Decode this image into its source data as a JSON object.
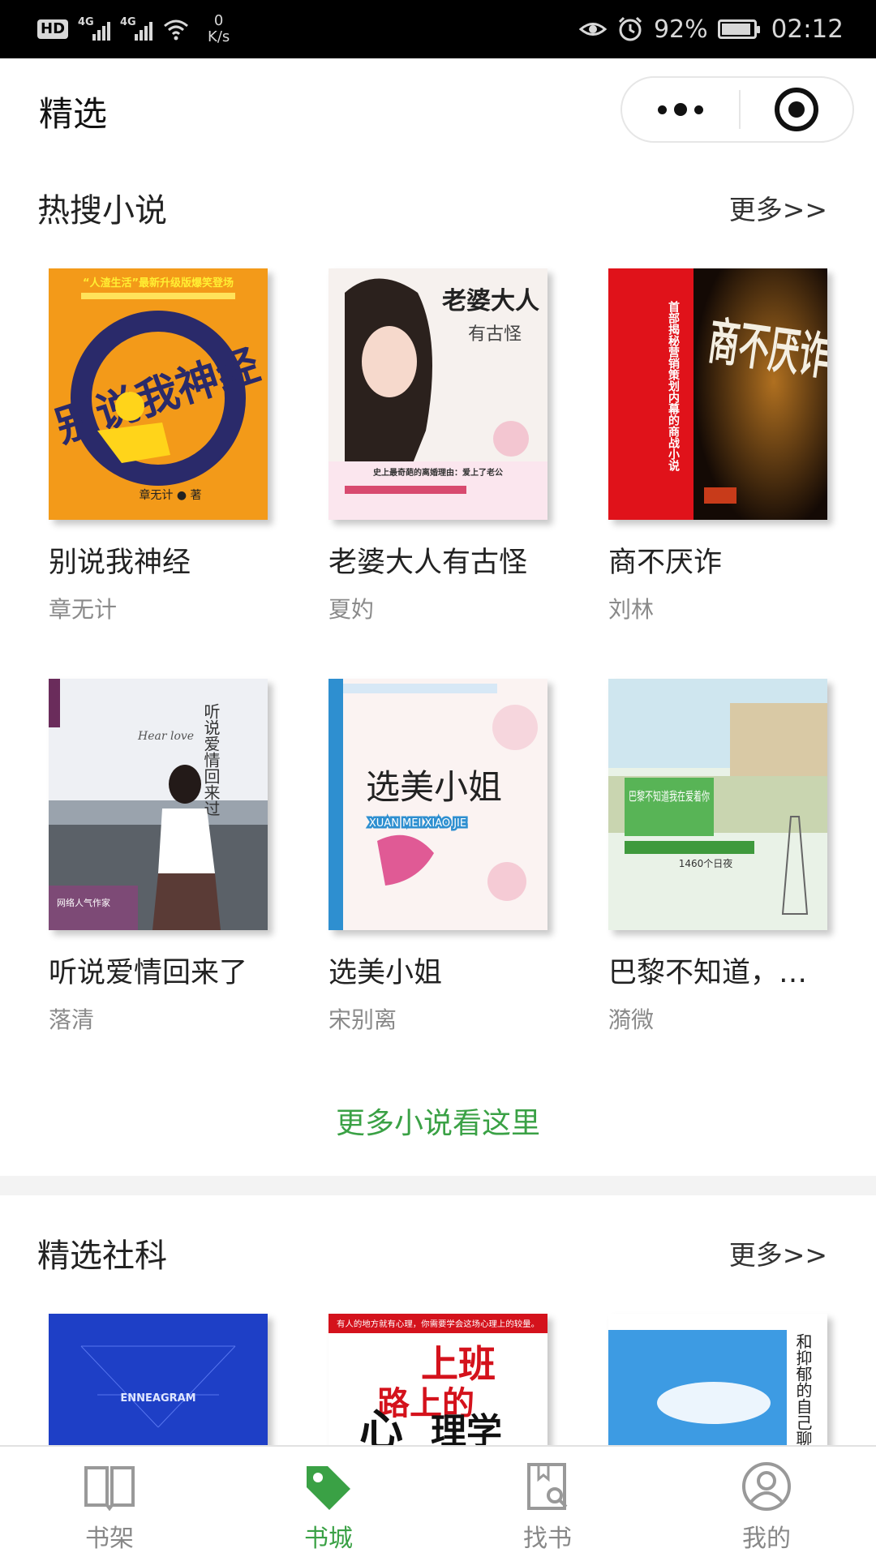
{
  "status_bar": {
    "hd": "HD",
    "net_type_1": "4G",
    "net_type_2": "4G",
    "speed_value": "0",
    "speed_unit": "K/s",
    "battery_percent": "92%",
    "battery_level": 0.92,
    "time": "02:12"
  },
  "header": {
    "title": "精选"
  },
  "sections": [
    {
      "title": "热搜小说",
      "more": "更多>>",
      "books": [
        {
          "title": "别说我神经",
          "author": "章无计"
        },
        {
          "title": "老婆大人有古怪",
          "author": "夏妁"
        },
        {
          "title": "商不厌诈",
          "author": "刘林"
        },
        {
          "title": "听说爱情回来了",
          "author": "落清"
        },
        {
          "title": "选美小姐",
          "author": "宋别离"
        },
        {
          "title": "巴黎不知道，我在爱着你",
          "author": "漪微"
        }
      ],
      "footer_link": "更多小说看这里"
    },
    {
      "title": "精选社科",
      "more": "更多>>",
      "books": [
        {
          "title": "",
          "author": ""
        },
        {
          "title": "",
          "author": ""
        },
        {
          "title": "",
          "author": ""
        }
      ]
    }
  ],
  "covers": {
    "c1": {
      "tagline": "“人渣生活”最新升级版爆笑登场",
      "art": "别说我神经",
      "by": "章无计 ● 著"
    },
    "c2": {
      "art": "老婆大人",
      "sub": "有古怪",
      "tagline": "史上最奇葩的离婚理由：爱上了老公"
    },
    "c3": {
      "art": "商不厌诈",
      "side": "首部揭秘营销策划内幕的商战小说"
    },
    "c4": {
      "art": "听说爱情回来过",
      "script": "Hear love",
      "badge": "网络人气作家"
    },
    "c5": {
      "art": "选美小姐",
      "pinyin": "XUAN MEI XIAO JIE"
    },
    "c6": {
      "art": "巴黎不知道我在爱着你",
      "sub": "1460个日夜"
    },
    "s1": {
      "art": "ENNEAGRAM"
    },
    "s2": {
      "tagline": "有人的地方就有心理，你需要学会这场心理上的较量。",
      "art1": "上班",
      "art2": "路上的",
      "art3": "心",
      "art4": "理学"
    },
    "s3": {
      "art": "和抑郁的自己聊聊吧"
    }
  },
  "tab_bar": {
    "items": [
      {
        "label": "书架",
        "icon": "book-open-icon",
        "active": false
      },
      {
        "label": "书城",
        "icon": "tag-icon",
        "active": true
      },
      {
        "label": "找书",
        "icon": "book-search-icon",
        "active": false
      },
      {
        "label": "我的",
        "icon": "user-icon",
        "active": false
      }
    ]
  },
  "colors": {
    "accent": "#3aa145",
    "status_bar_bg": "#000000",
    "author_text": "#8a8a8a"
  }
}
